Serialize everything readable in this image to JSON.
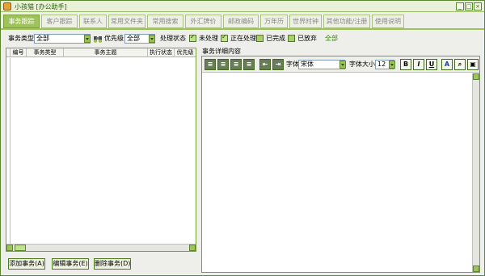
{
  "window": {
    "title": "小孩猫 [办公助手]",
    "controls": [
      "_",
      "□",
      "×"
    ]
  },
  "tabs": [
    {
      "label": "事务跟踪",
      "active": true
    },
    {
      "label": "客户跟踪",
      "active": false
    },
    {
      "label": "联系人",
      "active": false
    },
    {
      "label": "常用文件夹",
      "active": false
    },
    {
      "label": "常用搜索",
      "active": false
    },
    {
      "label": "外汇牌价",
      "active": false
    },
    {
      "label": "邮政编码",
      "active": false
    },
    {
      "label": "万年历",
      "active": false
    },
    {
      "label": "世界时钟",
      "active": false
    },
    {
      "label": "其他功能/注册",
      "active": false
    },
    {
      "label": "使用说明",
      "active": false
    }
  ],
  "filters": {
    "type_label": "事务类型",
    "type_value": "全部",
    "priority_label": "优先级",
    "priority_value": "全部",
    "status_label": "处理状态",
    "status_options": [
      {
        "label": "未处理",
        "checked": true
      },
      {
        "label": "正在处理",
        "checked": true
      },
      {
        "label": "已完成",
        "checked": false
      },
      {
        "label": "已放弃",
        "checked": false
      }
    ],
    "all_label": "全部"
  },
  "grid": {
    "columns": [
      "编号",
      "事务类型",
      "事务主题",
      "执行状态",
      "优先级"
    ]
  },
  "actions": {
    "add": "添加事务(A)",
    "edit": "编辑事务(E)",
    "delete": "删除事务(D)"
  },
  "detail": {
    "label": "事务详细内容",
    "font_label": "字体",
    "font_value": "宋体",
    "size_label": "字体大小",
    "size_value": "12",
    "bold": "B",
    "italic": "I",
    "underline": "U"
  },
  "colors": {
    "accent": "#9fc25c",
    "border": "#5b8a2e"
  }
}
